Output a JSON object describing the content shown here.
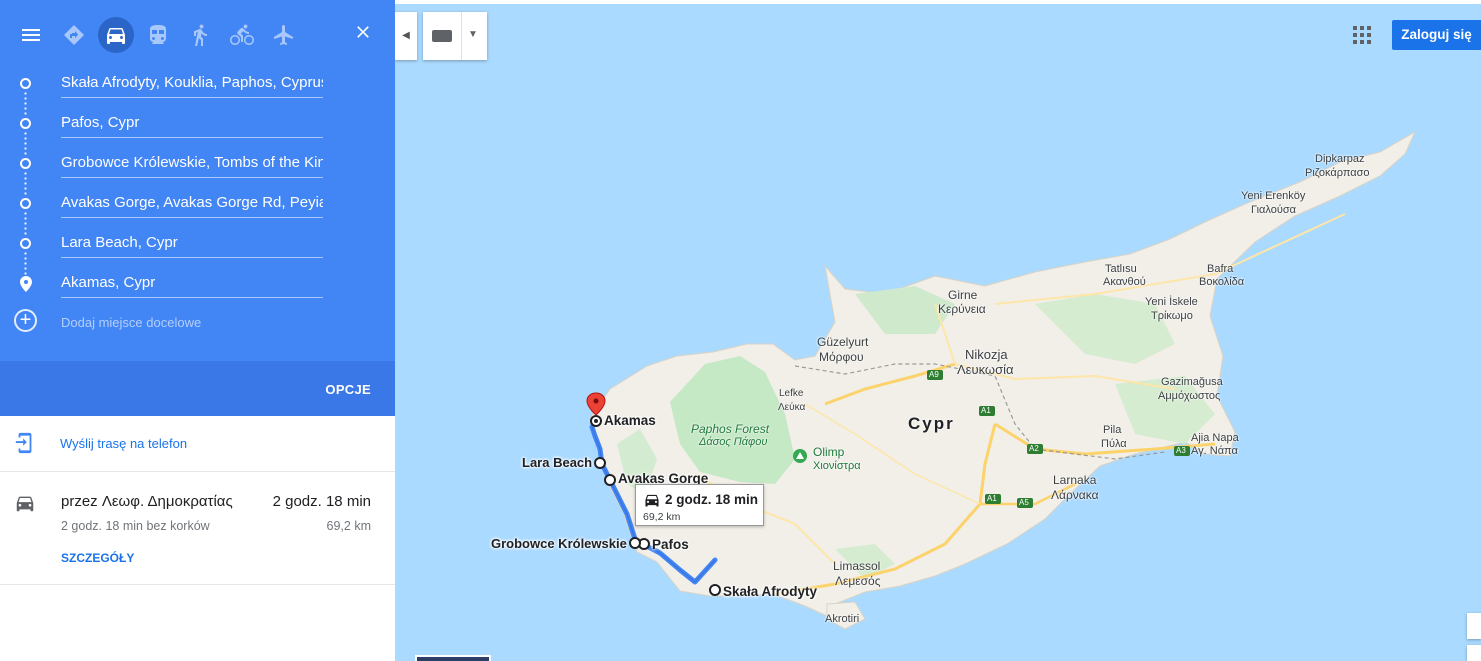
{
  "panel": {
    "modes": [
      {
        "name": "menu-icon"
      },
      {
        "name": "best-route-icon"
      },
      {
        "name": "car-icon"
      },
      {
        "name": "transit-icon"
      },
      {
        "name": "walk-icon"
      },
      {
        "name": "bicycle-icon"
      },
      {
        "name": "flight-icon"
      }
    ],
    "active_mode": "car-icon",
    "stops": [
      {
        "label": "Skała Afrodyty, Kouklia, Paphos, Cyprus"
      },
      {
        "label": "Pafos, Cypr"
      },
      {
        "label": "Grobowce Królewskie, Tombs of the Kings"
      },
      {
        "label": "Avakas Gorge, Avakas Gorge Rd, Peyia, Cyprus"
      },
      {
        "label": "Lara Beach, Cypr"
      },
      {
        "label": "Akamas, Cypr"
      }
    ],
    "add_destination_placeholder": "Dodaj miejsce docelowe",
    "options_label": "OPCJE",
    "send_to_phone_label": "Wyślij trasę na telefon",
    "route": {
      "via": "przez Λεωφ. Δημοκρατίας",
      "duration": "2 godz. 18 min",
      "traffic_note": "2 godz. 18 min bez korków",
      "distance": "69,2 km",
      "details_label": "SZCZEGÓŁY"
    }
  },
  "map": {
    "login_label": "Zaloguj się",
    "info_box": {
      "duration": "2 godz. 18 min",
      "distance": "69,2 km"
    },
    "waypoint_labels": {
      "akamas": "Akamas",
      "lara": "Lara Beach",
      "avakas": "Avakas Gorge",
      "grobowce": "Grobowce Królewskie",
      "pafos": "Pafos",
      "skala": "Skała Afrodyty"
    },
    "places": {
      "cypr": "Cypr",
      "paphos_forest_1": "Paphos Forest",
      "paphos_forest_2": "Δάσος Πάφου",
      "olimp_1": "Olimp",
      "olimp_2": "Χιονίστρα",
      "nikozja_1": "Nikozja",
      "nikozja_2": "Λευκωσία",
      "limassol_1": "Limassol",
      "limassol_2": "Λεμεσός",
      "larnaka_1": "Larnaka",
      "larnaka_2": "Λάρνακα",
      "girne_1": "Girne",
      "girne_2": "Κερύνεια",
      "guzelyurt_1": "Güzelyurt",
      "guzelyurt_2": "Μόρφου",
      "lefke_1": "Lefke",
      "lefke_2": "Λεύκα",
      "gazimagusa_1": "Gazimağusa",
      "gazimagusa_2": "Αμμόχωστος",
      "ajia_1": "Ajia Napa",
      "ajia_2": "Αγ. Νάπα",
      "pila_1": "Pila",
      "pila_2": "Πύλα",
      "tatlisu_1": "Tatlısu",
      "tatlisu_2": "Ακανθού",
      "bafra_1": "Bafra",
      "bafra_2": "Βοκολίδα",
      "yeni_iskele_1": "Yeni İskele",
      "yeni_iskele_2": "Τρίκωμο",
      "yeni_erenkoy_1": "Yeni Erenköy",
      "yeni_erenkoy_2": "Γιαλούσα",
      "dipkarpaz_1": "Dipkarpaz",
      "dipkarpaz_2": "Ριζοκάρπασο",
      "akrotiri": "Akrotiri"
    },
    "road_badges": [
      "A9",
      "A1",
      "A2",
      "A3",
      "A1",
      "A5"
    ],
    "colors": {
      "sea": "#aadaff",
      "land": "#f2efe9",
      "forest": "#c5e8c5",
      "route": "#4285f4",
      "panel": "#4285f4"
    }
  }
}
